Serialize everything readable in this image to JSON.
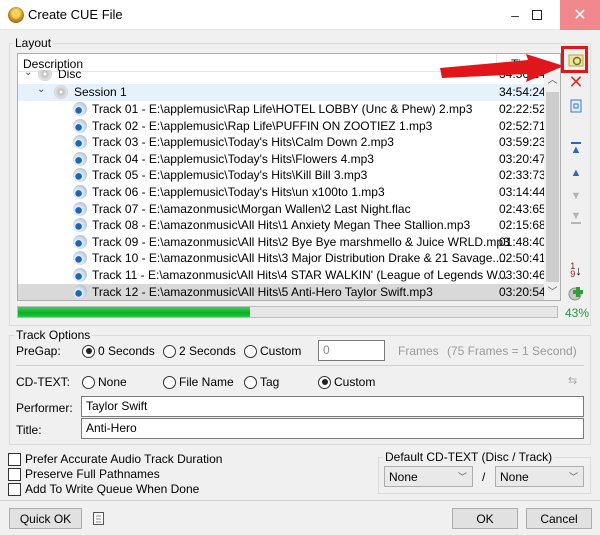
{
  "window": {
    "title": "Create CUE File",
    "minimize": "–",
    "close": "✕"
  },
  "layout": {
    "group_label": "Layout",
    "columns": {
      "description": "Description",
      "time": "Time"
    },
    "disc": {
      "label": "Disc",
      "time": "34:56:24"
    },
    "session": {
      "label": "Session 1",
      "time": "34:54:24"
    },
    "tracks": [
      {
        "desc": "Track 01 - E:\\applemusic\\Rap Life\\HOTEL LOBBY (Unc & Phew) 2.mp3",
        "time": "02:22:52"
      },
      {
        "desc": "Track 02 - E:\\applemusic\\Rap Life\\PUFFIN ON ZOOTIEZ 1.mp3",
        "time": "02:52:71"
      },
      {
        "desc": "Track 03 - E:\\applemusic\\Today's Hits\\Calm Down 2.mp3",
        "time": "03:59:23"
      },
      {
        "desc": "Track 04 - E:\\applemusic\\Today's Hits\\Flowers 4.mp3",
        "time": "03:20:47"
      },
      {
        "desc": "Track 05 - E:\\applemusic\\Today's Hits\\Kill Bill 3.mp3",
        "time": "02:33:73"
      },
      {
        "desc": "Track 06 - E:\\applemusic\\Today's Hits\\un x100to 1.mp3",
        "time": "03:14:44"
      },
      {
        "desc": "Track 07 - E:\\amazonmusic\\Morgan Wallen\\2 Last Night.flac",
        "time": "02:43:65"
      },
      {
        "desc": "Track 08 - E:\\amazonmusic\\All Hits\\1 Anxiety Megan Thee Stallion.mp3",
        "time": "02:15:68"
      },
      {
        "desc": "Track 09 - E:\\amazonmusic\\All Hits\\2 Bye Bye marshmello & Juice WRLD.mp3",
        "time": "01:48:40"
      },
      {
        "desc": "Track 10 - E:\\amazonmusic\\All Hits\\3 Major Distribution Drake & 21 Savage....",
        "time": "02:50:41"
      },
      {
        "desc": "Track 11 - E:\\amazonmusic\\All Hits\\4 STAR WALKIN' (League of Legends W...",
        "time": "03:30:46"
      },
      {
        "desc": "Track 12 - E:\\amazonmusic\\All Hits\\5 Anti-Hero Taylor Swift.mp3",
        "time": "03:20:54"
      }
    ],
    "selected_track_index": 11,
    "progress_percent": 43,
    "progress_label": "43%"
  },
  "side_toolbar": [
    "browse-icon",
    "delete-icon",
    "clear-icon",
    "move-top-icon",
    "move-up-icon",
    "move-down-icon",
    "move-bottom-icon",
    "sort-icon",
    "add-icon"
  ],
  "track_options": {
    "group_label": "Track Options",
    "pregap": {
      "label": "PreGap:",
      "options": [
        "0 Seconds",
        "2 Seconds",
        "Custom"
      ],
      "selected": "0 Seconds",
      "custom_value": "0",
      "frames_label": "Frames",
      "frames_hint": "(75 Frames = 1 Second)"
    },
    "cdtext": {
      "label": "CD-TEXT:",
      "options": [
        "None",
        "File Name",
        "Tag",
        "Custom"
      ],
      "selected": "Custom"
    },
    "performer": {
      "label": "Performer:",
      "value": "Taylor Swift"
    },
    "title": {
      "label": "Title:",
      "value": "Anti-Hero"
    }
  },
  "checkboxes": [
    {
      "label": "Prefer Accurate Audio Track Duration",
      "checked": false
    },
    {
      "label": "Preserve Full Pathnames",
      "checked": false
    },
    {
      "label": "Add To Write Queue When Done",
      "checked": false
    }
  ],
  "default_cdtext": {
    "label": "Default CD-TEXT (Disc / Track)",
    "disc_value": "None",
    "separator": "/",
    "track_value": "None"
  },
  "buttons": {
    "quick_ok": "Quick OK",
    "ok": "OK",
    "cancel": "Cancel"
  }
}
